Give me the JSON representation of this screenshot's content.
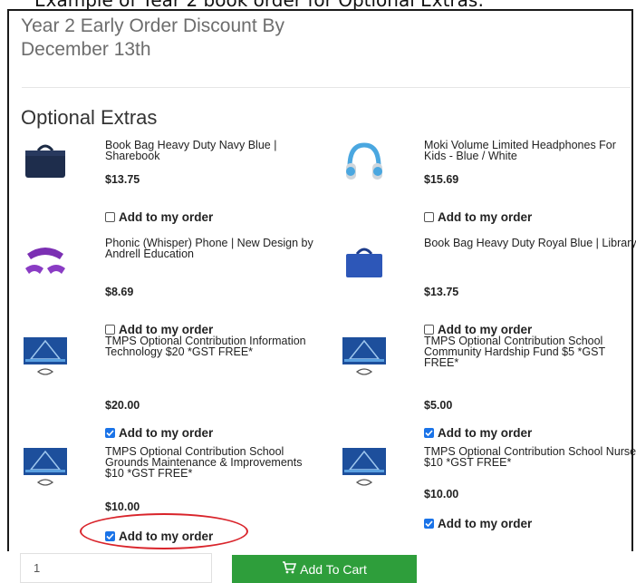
{
  "caption": "Example of Year 2 book order for Optional Extras:",
  "header": {
    "title": "Year 2 Early Order Discount By December 13th"
  },
  "section_title": "Optional Extras",
  "add_label": "Add to my order",
  "products": [
    {
      "name": "Book Bag Heavy Duty Navy Blue | Sharebook",
      "price": "$13.75",
      "checked": false,
      "icon": "navy-book-bag-icon"
    },
    {
      "name": "Moki Volume Limited Headphones For Kids - Blue / White",
      "price": "$15.69",
      "checked": false,
      "icon": "headphones-icon"
    },
    {
      "name": "Phonic (Whisper) Phone | New Design by Andrell Education",
      "price": "$8.69",
      "checked": false,
      "icon": "whisper-phone-icon"
    },
    {
      "name": "Book Bag Heavy Duty Royal Blue | Library",
      "price": "$13.75",
      "checked": false,
      "icon": "royal-book-bag-icon"
    },
    {
      "name": "TMPS Optional Contribution Information Technology $20 *GST FREE*",
      "price": "$20.00",
      "checked": true,
      "icon": "school-logo-icon"
    },
    {
      "name": "TMPS Optional Contribution School Community Hardship Fund $5 *GST FREE*",
      "price": "$5.00",
      "checked": true,
      "icon": "school-logo-icon"
    },
    {
      "name": "TMPS Optional Contribution School Grounds Maintenance & Improvements $10 *GST FREE*",
      "price": "$10.00",
      "checked": true,
      "icon": "school-logo-icon"
    },
    {
      "name": "TMPS Optional Contribution School Nurse $10 *GST FREE*",
      "price": "$10.00",
      "checked": true,
      "icon": "school-logo-icon"
    }
  ],
  "quantity": "1",
  "cart_button": "Add To Cart",
  "colors": {
    "accent": "#1a73e8",
    "cart": "#2e9e3b",
    "highlight": "#d9242b"
  }
}
